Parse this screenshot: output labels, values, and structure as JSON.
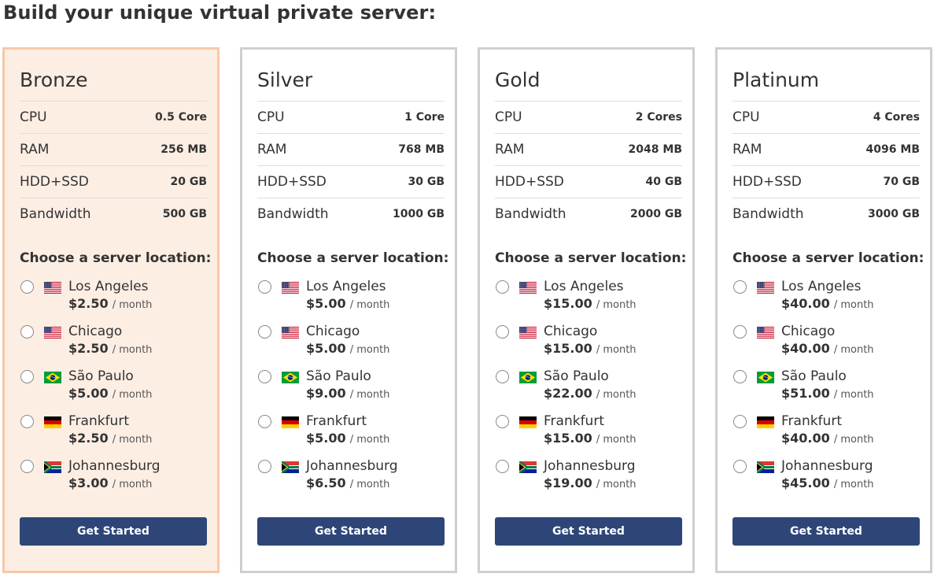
{
  "page": {
    "title": "Build your unique virtual private server:"
  },
  "theme": {
    "button_color": "#2e4677",
    "selected_card_border": "#f8c8a8",
    "selected_card_background": "#fdeee4",
    "card_border": "#cfcfcf"
  },
  "plans": [
    {
      "name": "Bronze",
      "selected": true,
      "specs": [
        {
          "label": "CPU",
          "value": "0.5 Core"
        },
        {
          "label": "RAM",
          "value": "256 MB"
        },
        {
          "label": "HDD+SSD",
          "value": "20 GB"
        },
        {
          "label": "Bandwidth",
          "value": "500 GB"
        }
      ],
      "locations_heading": "Choose a server location:",
      "locations": [
        {
          "city": "Los Angeles",
          "flag": "us-flag-icon",
          "price": "$2.50",
          "period": "/ month",
          "checked": false
        },
        {
          "city": "Chicago",
          "flag": "us-flag-icon",
          "price": "$2.50",
          "period": "/ month",
          "checked": false
        },
        {
          "city": "São Paulo",
          "flag": "br-flag-icon",
          "price": "$5.00",
          "period": "/ month",
          "checked": false
        },
        {
          "city": "Frankfurt",
          "flag": "de-flag-icon",
          "price": "$2.50",
          "period": "/ month",
          "checked": false
        },
        {
          "city": "Johannesburg",
          "flag": "za-flag-icon",
          "price": "$3.00",
          "period": "/ month",
          "checked": false
        }
      ],
      "cta": "Get Started"
    },
    {
      "name": "Silver",
      "selected": false,
      "specs": [
        {
          "label": "CPU",
          "value": "1 Core"
        },
        {
          "label": "RAM",
          "value": "768 MB"
        },
        {
          "label": "HDD+SSD",
          "value": "30 GB"
        },
        {
          "label": "Bandwidth",
          "value": "1000 GB"
        }
      ],
      "locations_heading": "Choose a server location:",
      "locations": [
        {
          "city": "Los Angeles",
          "flag": "us-flag-icon",
          "price": "$5.00",
          "period": "/ month",
          "checked": false
        },
        {
          "city": "Chicago",
          "flag": "us-flag-icon",
          "price": "$5.00",
          "period": "/ month",
          "checked": false
        },
        {
          "city": "São Paulo",
          "flag": "br-flag-icon",
          "price": "$9.00",
          "period": "/ month",
          "checked": false
        },
        {
          "city": "Frankfurt",
          "flag": "de-flag-icon",
          "price": "$5.00",
          "period": "/ month",
          "checked": false
        },
        {
          "city": "Johannesburg",
          "flag": "za-flag-icon",
          "price": "$6.50",
          "period": "/ month",
          "checked": false
        }
      ],
      "cta": "Get Started"
    },
    {
      "name": "Gold",
      "selected": false,
      "specs": [
        {
          "label": "CPU",
          "value": "2 Cores"
        },
        {
          "label": "RAM",
          "value": "2048 MB"
        },
        {
          "label": "HDD+SSD",
          "value": "40 GB"
        },
        {
          "label": "Bandwidth",
          "value": "2000 GB"
        }
      ],
      "locations_heading": "Choose a server location:",
      "locations": [
        {
          "city": "Los Angeles",
          "flag": "us-flag-icon",
          "price": "$15.00",
          "period": "/ month",
          "checked": false
        },
        {
          "city": "Chicago",
          "flag": "us-flag-icon",
          "price": "$15.00",
          "period": "/ month",
          "checked": false
        },
        {
          "city": "São Paulo",
          "flag": "br-flag-icon",
          "price": "$22.00",
          "period": "/ month",
          "checked": false
        },
        {
          "city": "Frankfurt",
          "flag": "de-flag-icon",
          "price": "$15.00",
          "period": "/ month",
          "checked": false
        },
        {
          "city": "Johannesburg",
          "flag": "za-flag-icon",
          "price": "$19.00",
          "period": "/ month",
          "checked": false
        }
      ],
      "cta": "Get Started"
    },
    {
      "name": "Platinum",
      "selected": false,
      "specs": [
        {
          "label": "CPU",
          "value": "4 Cores"
        },
        {
          "label": "RAM",
          "value": "4096 MB"
        },
        {
          "label": "HDD+SSD",
          "value": "70 GB"
        },
        {
          "label": "Bandwidth",
          "value": "3000 GB"
        }
      ],
      "locations_heading": "Choose a server location:",
      "locations": [
        {
          "city": "Los Angeles",
          "flag": "us-flag-icon",
          "price": "$40.00",
          "period": "/ month",
          "checked": false
        },
        {
          "city": "Chicago",
          "flag": "us-flag-icon",
          "price": "$40.00",
          "period": "/ month",
          "checked": false
        },
        {
          "city": "São Paulo",
          "flag": "br-flag-icon",
          "price": "$51.00",
          "period": "/ month",
          "checked": false
        },
        {
          "city": "Frankfurt",
          "flag": "de-flag-icon",
          "price": "$40.00",
          "period": "/ month",
          "checked": false
        },
        {
          "city": "Johannesburg",
          "flag": "za-flag-icon",
          "price": "$45.00",
          "period": "/ month",
          "checked": false
        }
      ],
      "cta": "Get Started"
    }
  ]
}
